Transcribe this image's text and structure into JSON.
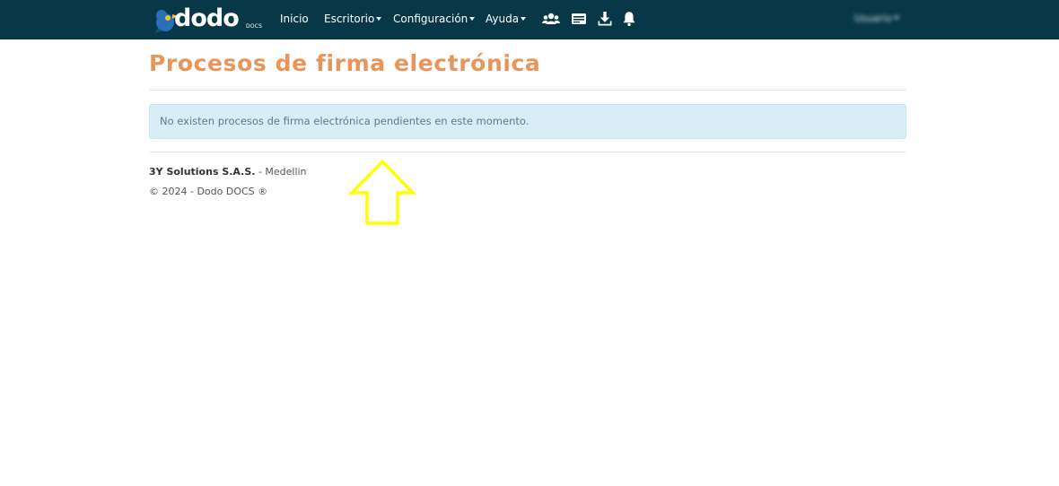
{
  "navbar": {
    "brand": {
      "word": "dodo",
      "sub": "DOCS"
    },
    "links": {
      "inicio": "Inicio",
      "escritorio": "Escritorio",
      "configuracion": "Configuración",
      "ayuda": "Ayuda"
    },
    "icons": [
      "users-icon",
      "id-card-icon",
      "download-icon",
      "bell-icon"
    ],
    "user": "Usuario"
  },
  "page": {
    "title": "Procesos de firma electrónica",
    "alert": "No existen procesos de firma electrónica pendientes en este momento."
  },
  "footer": {
    "company": "3Y Solutions S.A.S.",
    "city": " - Medellin",
    "copyright": "© 2024 - Dodo DOCS ®"
  },
  "colors": {
    "navbar_bg": "#083847",
    "title": "#e8955a",
    "alert_bg": "#d9edf7",
    "alert_text": "#5a7a8f",
    "annotation_arrow": "#ffff00"
  }
}
